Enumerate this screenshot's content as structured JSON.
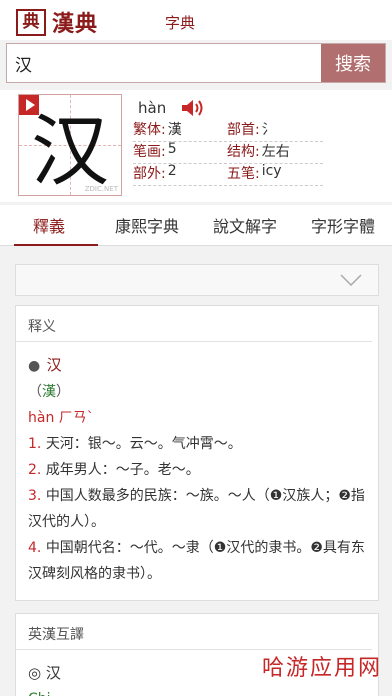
{
  "app": {
    "logo_mark": "典",
    "logo_text": "漢典",
    "nav_label": "字典"
  },
  "search": {
    "value": "汉",
    "button_label": "搜索"
  },
  "character": {
    "glyph": "汉",
    "pinyin": "hàn",
    "watermark": "ZDIC.NET",
    "rows": [
      [
        {
          "label": "繁体:",
          "value": "漢"
        },
        {
          "label": "部首:",
          "value": "氵"
        }
      ],
      [
        {
          "label": "笔画:",
          "value": "5"
        },
        {
          "label": "结构:",
          "value": "左右"
        }
      ],
      [
        {
          "label": "部外:",
          "value": "2"
        },
        {
          "label": "五笔:",
          "value": "icy"
        }
      ]
    ]
  },
  "tabs": [
    {
      "label": "釋義",
      "active": true
    },
    {
      "label": "康熙字典",
      "active": false
    },
    {
      "label": "說文解字",
      "active": false
    },
    {
      "label": "字形字體",
      "active": false
    }
  ],
  "definitions": {
    "title": "释义",
    "head_char": "汉",
    "traditional": "漢",
    "pinyin_line": "hàn ㄏㄢˋ",
    "items": [
      {
        "num": "1.",
        "text": "天河：银～。云～。气冲霄～。"
      },
      {
        "num": "2.",
        "text": "成年男人：～子。老～。"
      },
      {
        "num": "3.",
        "text": "中国人数最多的民族：～族。～人（❶汉族人；❷指汉代的人）。"
      },
      {
        "num": "4.",
        "text": "中国朝代名：～代。～隶（❶汉代的隶书。❷具有东汉碑刻风格的隶书）。"
      }
    ]
  },
  "english": {
    "title": "英漢互譯",
    "head": "◎ 汉",
    "cut_text": "Chi"
  },
  "overlay": {
    "watermark": "哈游应用网"
  },
  "colors": {
    "brand": "#8b1a1a",
    "accent_red": "#c62828",
    "search_button": "#b26f6f",
    "green": "#2e7d32"
  },
  "icons": {
    "play": "play-icon",
    "speaker": "speaker-icon",
    "dropdown": "chevron-down-icon"
  }
}
